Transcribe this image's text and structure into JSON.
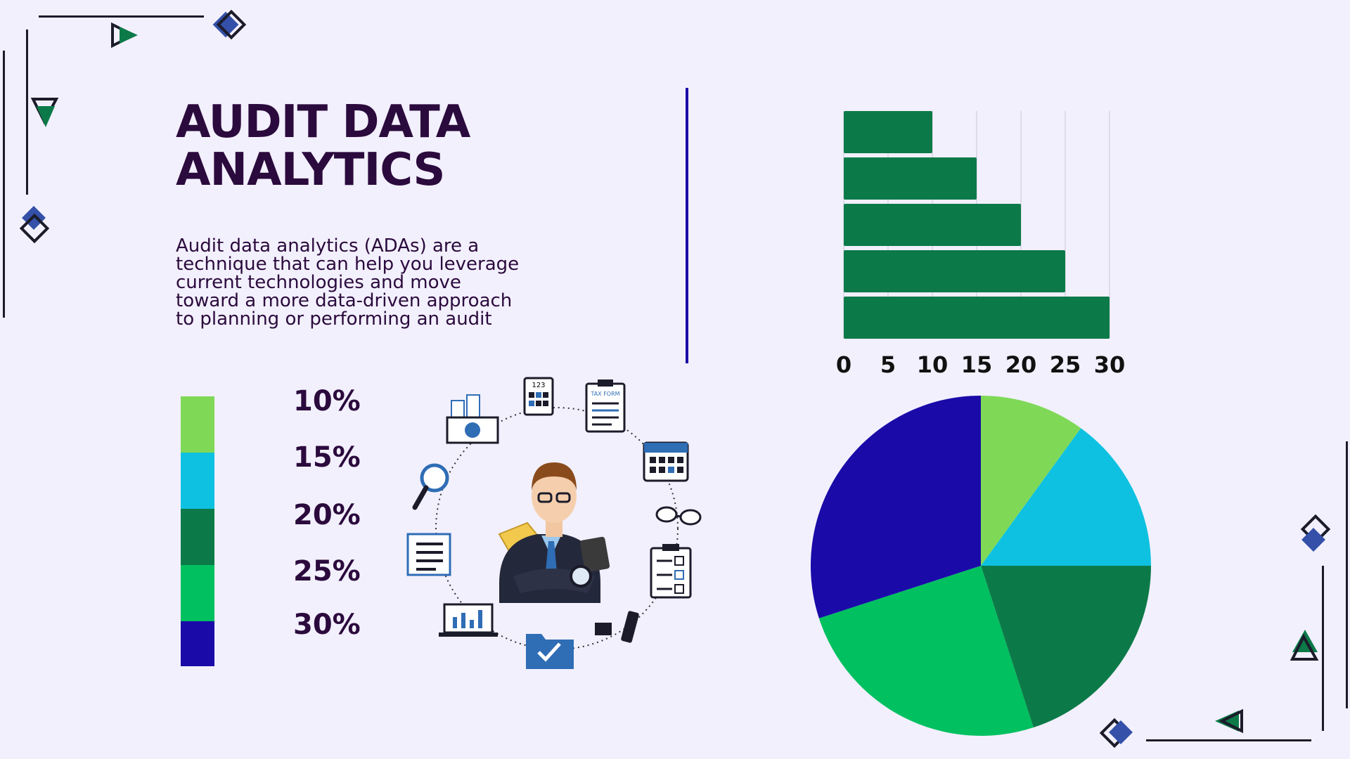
{
  "title": "AUDIT DATA\nANALYTICS",
  "description": "Audit data analytics (ADAs) are a technique that can help you leverage current technologies and move toward a more data-driven approach to planning or performing an audit",
  "colors": {
    "background": "#f2f0fd",
    "title": "#2b0a3d",
    "divider": "#1b0aa6",
    "light_green": "#7fd957",
    "cyan": "#0ec1e0",
    "dark_green": "#0c7a48",
    "green": "#00c060",
    "navy": "#1a0aa8",
    "bar": "#0c7a48",
    "deco_blue": "#3450a8",
    "deco_green": "#0c7a48"
  },
  "legend": [
    {
      "label": "10%",
      "color": "#7fd957"
    },
    {
      "label": "15%",
      "color": "#0ec1e0"
    },
    {
      "label": "20%",
      "color": "#0c7a48"
    },
    {
      "label": "25%",
      "color": "#00c060"
    },
    {
      "label": "30%",
      "color": "#1a0aa8"
    }
  ],
  "illustration": {
    "icons": [
      "calculator-icon",
      "tax-form-icon",
      "calendar-icon",
      "glasses-icon",
      "checklist-icon",
      "usb-drive-icon",
      "folder-check-icon",
      "laptop-chart-icon",
      "document-list-icon",
      "magnifier-icon",
      "money-coins-icon",
      "auditor-man-icon"
    ],
    "calc_text": "123",
    "form_text": "TAX FORM"
  },
  "chart_data": [
    {
      "type": "bar",
      "orientation": "horizontal",
      "values": [
        10,
        15,
        20,
        25,
        30
      ],
      "xlim": [
        0,
        30
      ],
      "xticks": [
        "0",
        "5",
        "10",
        "15",
        "20",
        "25",
        "30"
      ],
      "grid": true,
      "color": "#0c7a48"
    },
    {
      "type": "pie",
      "values": [
        10,
        15,
        20,
        25,
        30
      ],
      "colors": [
        "#7fd957",
        "#0ec1e0",
        "#0c7a48",
        "#00c060",
        "#1a0aa8"
      ],
      "start": "top",
      "direction": "clockwise"
    }
  ]
}
